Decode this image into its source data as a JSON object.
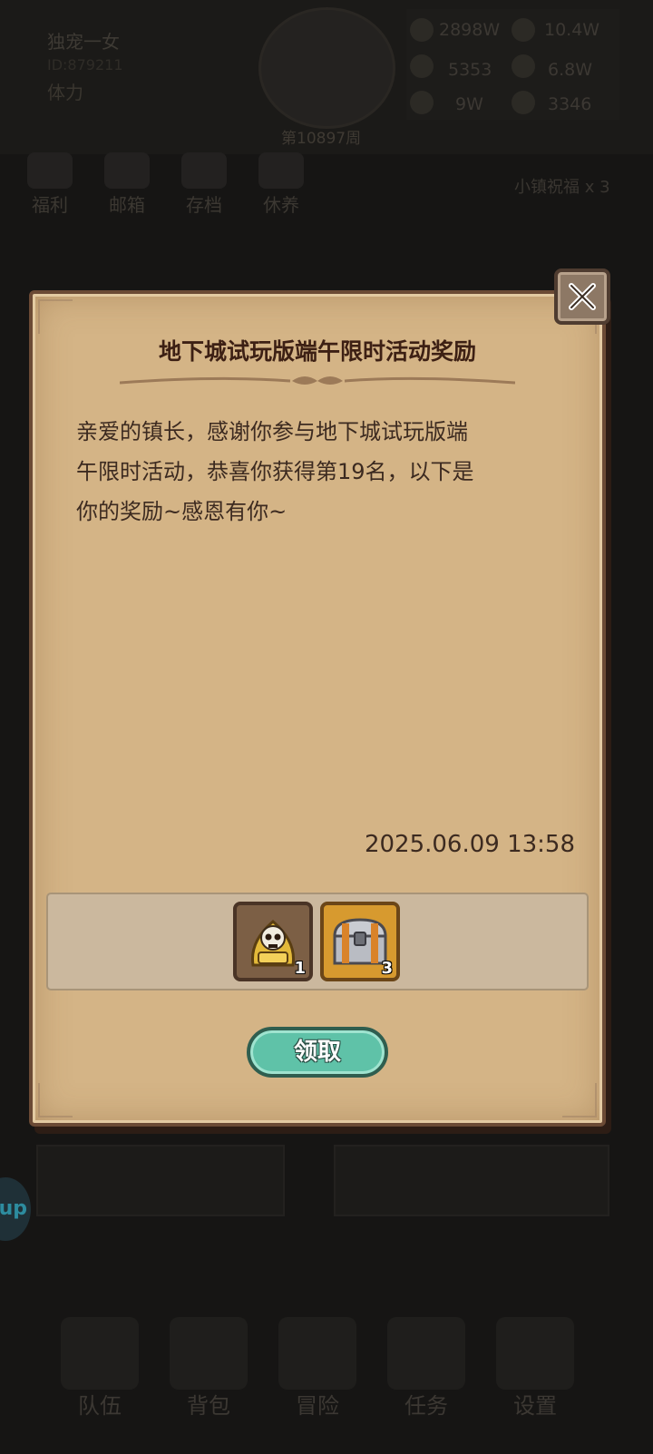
{
  "background": {
    "player_name": "独宠一女",
    "player_id": "ID:879211",
    "stamina_label": "体力",
    "week": "第10897周",
    "resources": [
      "2898W",
      "10.4W",
      "5353",
      "6.8W",
      "9W",
      "3346"
    ],
    "menu": [
      "福利",
      "邮箱",
      "存档",
      "休养"
    ],
    "bless": "小镇祝福 x 3",
    "side_button": "up",
    "nav": [
      "队伍",
      "背包",
      "冒险",
      "任务",
      "设置"
    ]
  },
  "mail": {
    "title": "地下城试玩版端午限时活动奖励",
    "message": "亲爱的镇长，感谢你参与地下城试玩版端\n午限时活动，恭喜你获得第19名，以下是\n你的奖励~感恩有你~",
    "timestamp": "2025.06.09 13:58",
    "rewards": [
      {
        "icon": "skull-bell-icon",
        "count": "1"
      },
      {
        "icon": "treasure-chest-icon",
        "count": "3"
      }
    ],
    "claim_label": "领取"
  },
  "colors": {
    "parchment": "#d4b486",
    "frame": "#6b4a35",
    "title_text": "#3d2014",
    "claim_button": "#5fc2a8"
  }
}
